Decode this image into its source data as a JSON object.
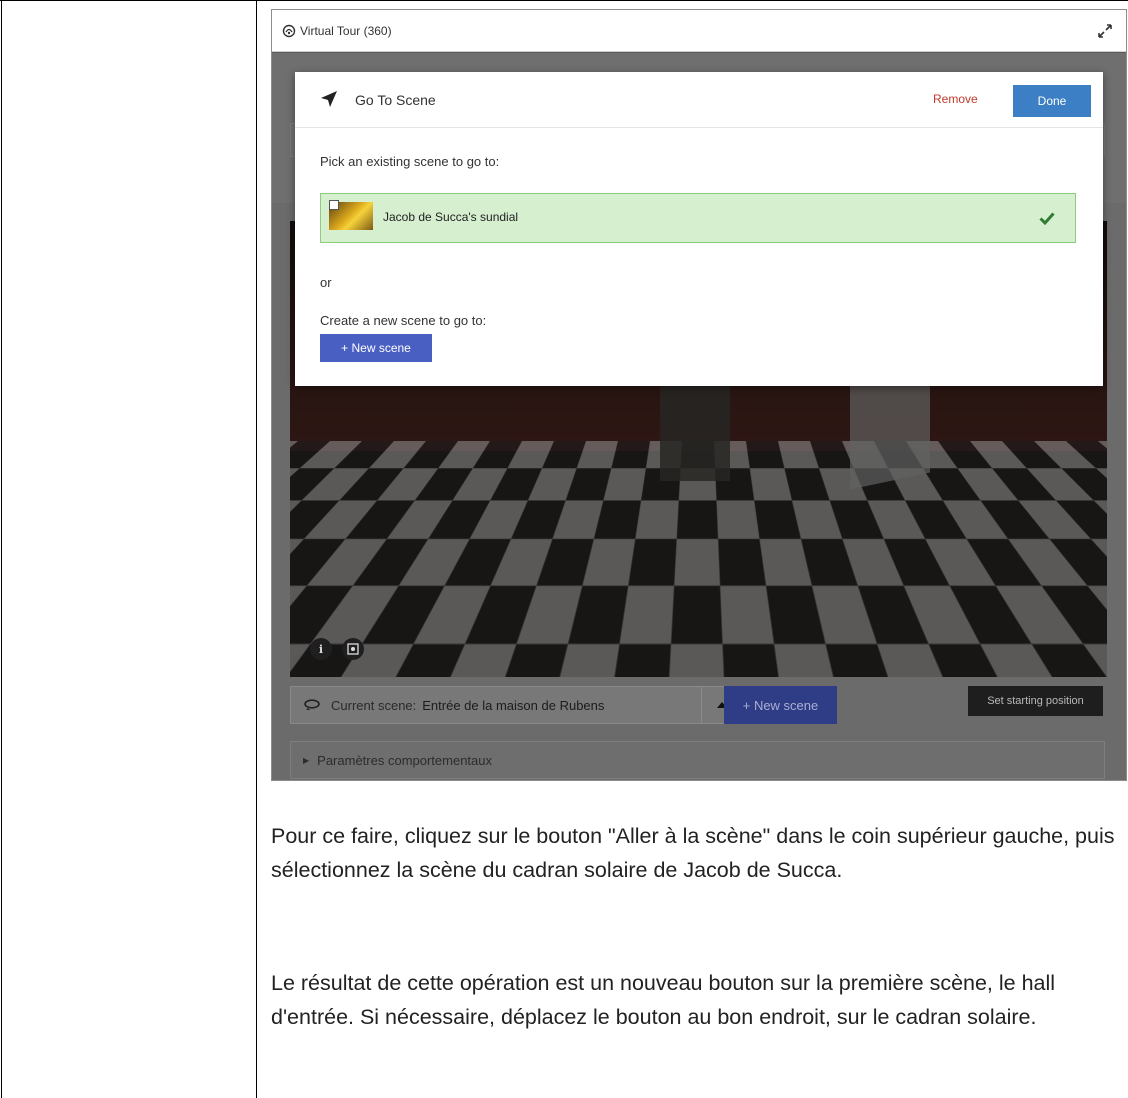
{
  "tour": {
    "title": "Virtual Tour (360)"
  },
  "modal": {
    "title": "Go To Scene",
    "remove_label": "Remove",
    "done_label": "Done",
    "pick_label": "Pick an existing scene to go to:",
    "selected_scene": "Jacob de Succa's sundial",
    "or_label": "or",
    "create_label": "Create a new scene to go to:",
    "new_scene_label": "+ New scene"
  },
  "scene_bar": {
    "current_label": "Current scene:",
    "current_value": "Entrée de la maison de Rubens",
    "new_scene_label": "+ New scene",
    "set_start_label": "Set starting position"
  },
  "params": {
    "label": "Paramètres comportementaux"
  },
  "pano_controls": {
    "info": "i"
  },
  "text": {
    "paragraph_1": "Pour ce faire, cliquez sur le bouton \"Aller à la scène\" dans le coin supérieur gauche, puis sélectionnez la scène du cadran solaire de Jacob de Succa.",
    "paragraph_2": "Le résultat de cette opération est un nouveau bouton sur la première scène, le hall d'entrée.  Si nécessaire, déplacez le bouton au bon endroit, sur le cadran solaire."
  },
  "icons": {
    "tour": "tour-360-icon",
    "fullscreen": "fullscreen-icon",
    "navigate": "navigation-arrow-icon",
    "check": "check-icon",
    "info": "info-icon",
    "focus": "focus-icon",
    "scene_loop": "scene-loop-icon",
    "caret_up": "caret-up-icon",
    "caret_right": "caret-right-icon"
  },
  "colors": {
    "done": "#3d7fc4",
    "remove": "#c0392b",
    "selected_bg": "#d6efcf",
    "selected_border": "#8fcc82",
    "new_scene": "#4a5fc2",
    "check": "#2e7d32"
  }
}
